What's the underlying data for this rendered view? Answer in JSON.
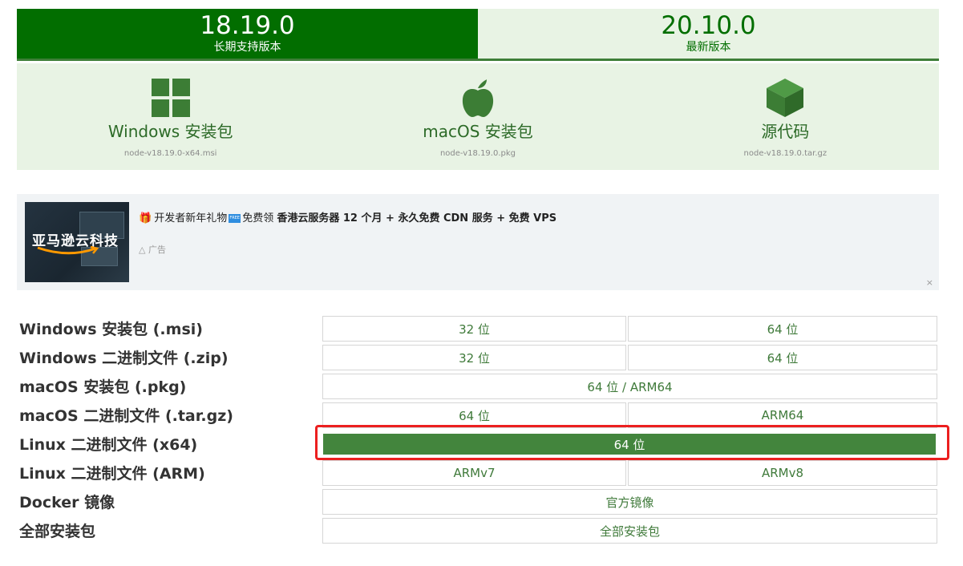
{
  "versions": [
    {
      "version": "18.19.0",
      "label": "长期支持版本",
      "active": true
    },
    {
      "version": "20.10.0",
      "label": "最新版本",
      "active": false
    }
  ],
  "cards": [
    {
      "name": "Windows 安装包",
      "file": "node-v18.19.0-x64.msi",
      "icon": "windows-icon"
    },
    {
      "name": "macOS 安装包",
      "file": "node-v18.19.0.pkg",
      "icon": "apple-icon"
    },
    {
      "name": "源代码",
      "file": "node-v18.19.0.tar.gz",
      "icon": "box-icon"
    }
  ],
  "ad": {
    "image_brand": "亚马逊云科技",
    "text_a": "开发者新年礼物",
    "free_badge": "FREE",
    "text_b": "免费领",
    "text_bold": "香港云服务器 12 个月 + 永久免费 CDN 服务 + 免费 VPS",
    "label": "广告",
    "close": "×"
  },
  "downloads": [
    {
      "label": "Windows 安装包 (.msi)",
      "buttons": [
        "32 位",
        "64 位"
      ]
    },
    {
      "label": "Windows 二进制文件 (.zip)",
      "buttons": [
        "32 位",
        "64 位"
      ]
    },
    {
      "label": "macOS 安装包 (.pkg)",
      "buttons": [
        "64 位 / ARM64"
      ]
    },
    {
      "label": "macOS 二进制文件 (.tar.gz)",
      "buttons": [
        "64 位",
        "ARM64"
      ]
    },
    {
      "label": "Linux 二进制文件 (x64)",
      "buttons": [
        "64 位"
      ]
    },
    {
      "label": "Linux 二进制文件 (ARM)",
      "buttons": [
        "ARMv7",
        "ARMv8"
      ]
    },
    {
      "label": "Docker 镜像",
      "buttons": [
        "官方镜像"
      ]
    },
    {
      "label": "全部安装包",
      "buttons": [
        "全部安装包"
      ]
    }
  ],
  "colors": {
    "primary": "#026e00",
    "accent": "#43853d",
    "tab_bg": "#e8f3e4",
    "highlight": "#ec1f1f"
  }
}
